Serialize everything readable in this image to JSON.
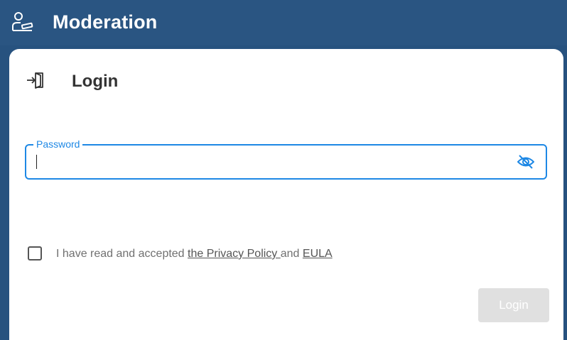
{
  "header": {
    "title": "Moderation",
    "logo_icon": "moderator-user-icon",
    "background": "#2a5582"
  },
  "login": {
    "heading": "Login",
    "heading_icon": "login-enter-icon",
    "password": {
      "label": "Password",
      "value": "",
      "visibility_icon": "eye-off-icon"
    },
    "consent": {
      "prefix": "I have read and accepted ",
      "privacy_link": "the Privacy Policy ",
      "middle": "and ",
      "eula_link": "EULA",
      "checked": false
    },
    "submit_label": "Login",
    "accent_color": "#1e88e5"
  }
}
